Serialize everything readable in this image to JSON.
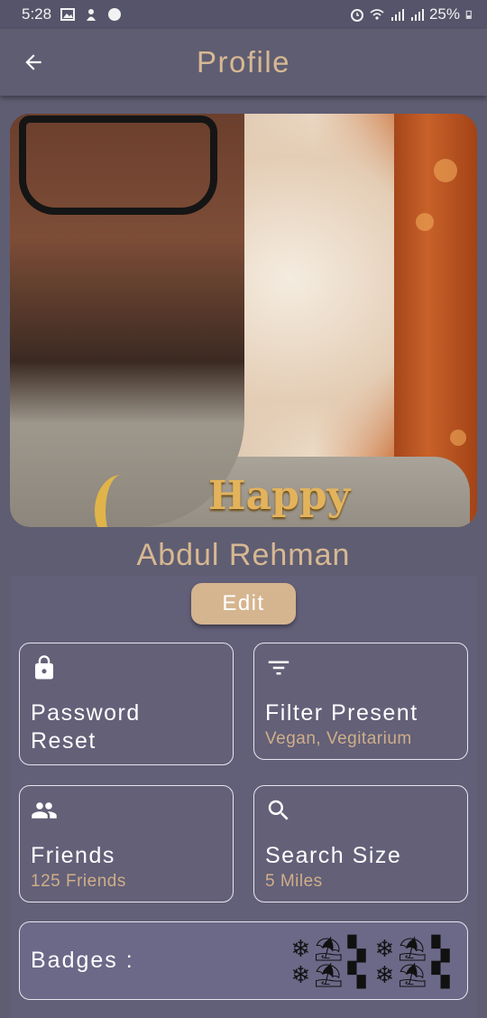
{
  "status_bar": {
    "time": "5:28",
    "battery": "25%"
  },
  "app_bar": {
    "title": "Profile"
  },
  "profile": {
    "name": "Abdul Rehman",
    "photo_overlay_text": "Happy"
  },
  "edit_button": {
    "label": "Edit"
  },
  "cards": {
    "password": {
      "title_line1": "Password",
      "title_line2": "Reset",
      "icon": "lock-icon"
    },
    "filter": {
      "title": "Filter Present",
      "subtitle": "Vegan, Vegitarium",
      "icon": "filter-icon"
    },
    "friends": {
      "title": "Friends",
      "subtitle": "125 Friends",
      "icon": "people-icon"
    },
    "search": {
      "title": "Search Size",
      "subtitle": "5 Miles",
      "icon": "search-icon"
    }
  },
  "badges": {
    "label": "Badges :",
    "glyphs": [
      "❄",
      "⛱",
      "▚",
      "❄",
      "⛱",
      "▚",
      "❄",
      "⛱",
      "▚",
      "❄",
      "⛱",
      "▚"
    ]
  },
  "colors": {
    "background": "#5f5d72",
    "accent": "#d7b892",
    "card_border": "#e9e6f0"
  }
}
